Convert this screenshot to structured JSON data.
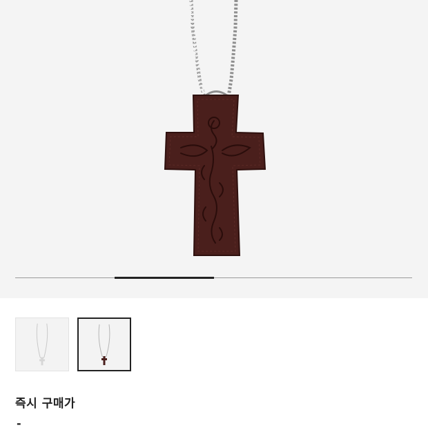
{
  "product": {
    "image_icon": "cross-pendant-necklace",
    "colors": {
      "leather": "#4a1f1c",
      "chain": "#9a9a9a",
      "background": "#f4f4f4"
    }
  },
  "gallery": {
    "slide_count": 4,
    "active_slide": 2
  },
  "thumbnails": [
    {
      "variant": "silver",
      "selected": false
    },
    {
      "variant": "brown",
      "selected": true
    }
  ],
  "purchase": {
    "title": "즉시 구매가",
    "price": "-"
  }
}
